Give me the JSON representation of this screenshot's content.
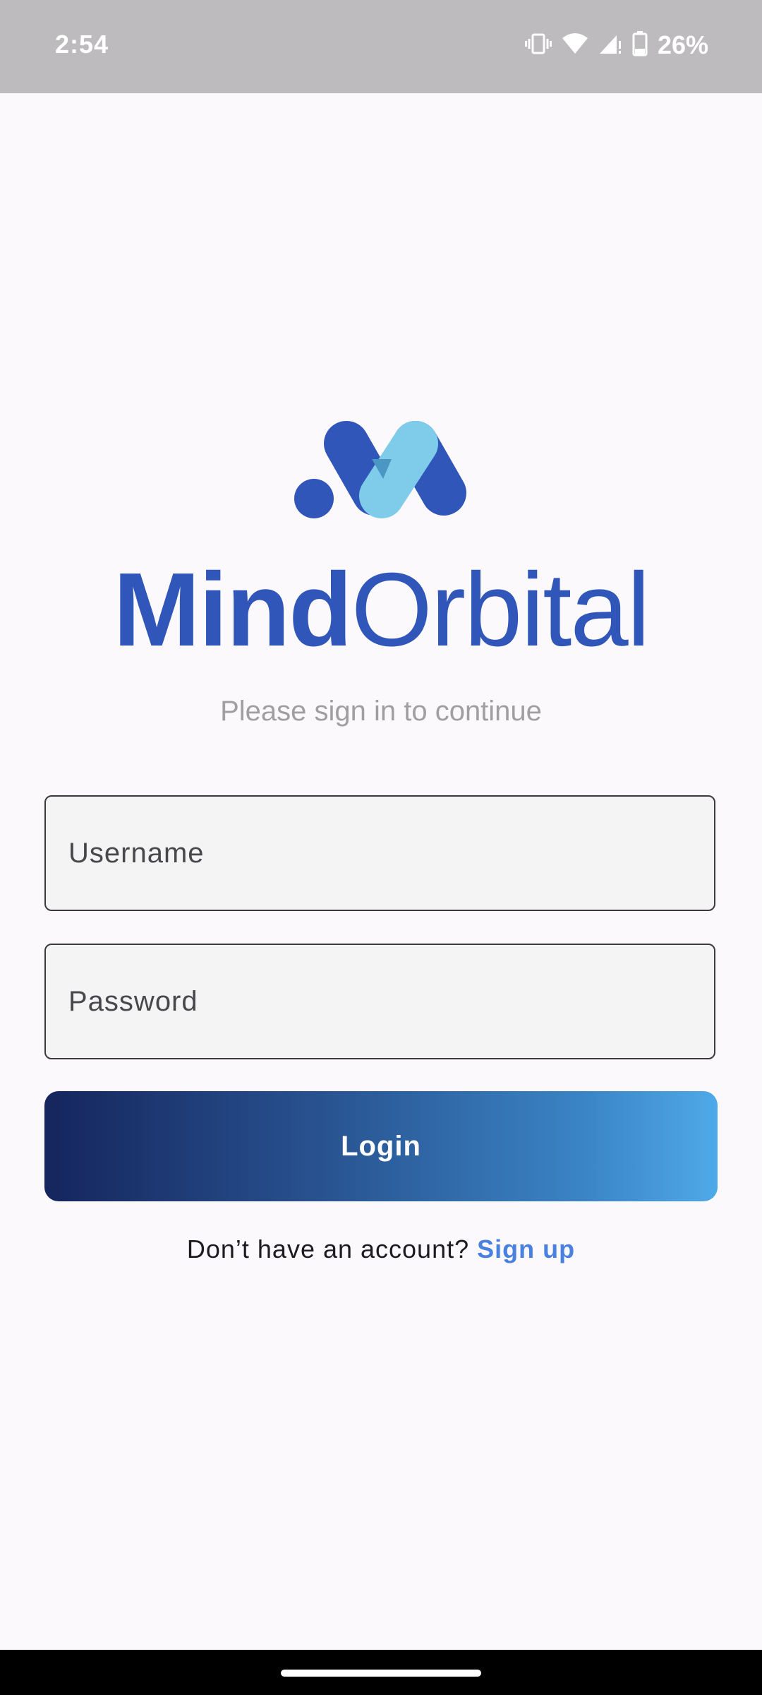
{
  "status_bar": {
    "time": "2:54",
    "battery": "26%",
    "icons": [
      "vibrate-icon",
      "wifi-icon",
      "signal-icon",
      "battery-icon"
    ]
  },
  "logo": {
    "brand_bold": "Mind",
    "brand_regular": "Orbital",
    "colors": {
      "dark_blue": "#2f56b8",
      "light_blue": "#7ecbea",
      "overlap_blue": "#4b97c4"
    }
  },
  "login_form": {
    "subtitle": "Please sign in to continue",
    "username_placeholder": "Username",
    "password_placeholder": "Password",
    "login_label": "Login",
    "gradient_colors": [
      "#15255d",
      "#4fa9e8"
    ]
  },
  "signup": {
    "prompt": "Don’t have an account?",
    "link_label": "Sign up",
    "link_color": "#4a80e0"
  }
}
